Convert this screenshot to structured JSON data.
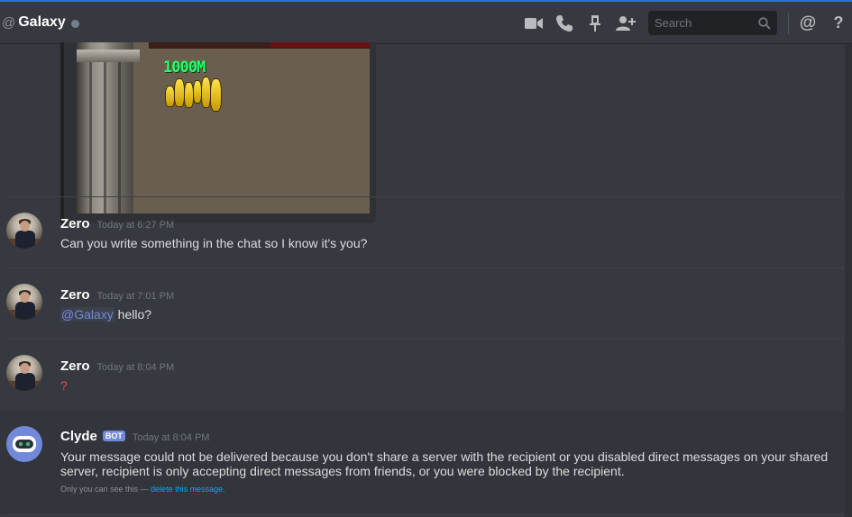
{
  "header": {
    "at_symbol": "@",
    "dm_name": "Galaxy",
    "status": "offline",
    "search_placeholder": "Search",
    "icons": [
      "video-call-icon",
      "voice-call-icon",
      "pin-icon",
      "add-friend-icon",
      "search-icon",
      "mentions-icon",
      "help-icon"
    ],
    "mentions_glyph": "@",
    "help_glyph": "?"
  },
  "embed": {
    "image_text": "1000M"
  },
  "messages": [
    {
      "author": "Zero",
      "timestamp": "Today at 6:27 PM",
      "content": "Can you write something in the chat so I know it's you?"
    },
    {
      "author": "Zero",
      "timestamp": "Today at 7:01 PM",
      "mention": "@Galaxy",
      "content": " hello?"
    },
    {
      "author": "Zero",
      "timestamp": "Today at 8:04 PM",
      "content": "?"
    },
    {
      "author": "Clyde",
      "badge": "BOT",
      "timestamp": "Today at 8:04 PM",
      "content": "Your message could not be delivered because you don't share a server with the recipient or you disabled direct messages on your shared server, recipient is only accepting direct messages from friends, or you were blocked by the recipient.",
      "ephemeral_note": "Only you can see this — ",
      "ephemeral_link": "delete this message."
    }
  ],
  "colors": {
    "background": "#36393f",
    "accent": "#7289da",
    "link": "#00b0f4",
    "error": "#f04747"
  }
}
